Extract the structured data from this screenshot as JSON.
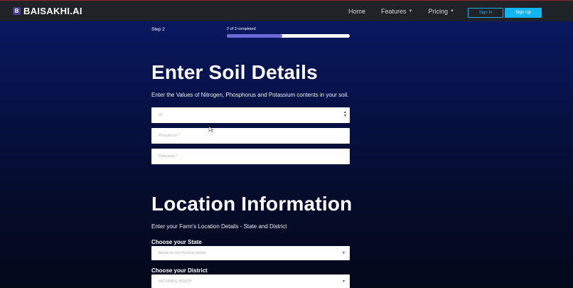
{
  "brand": {
    "badge": "B",
    "name": "BAISAKHI.AI"
  },
  "nav": {
    "home": "Home",
    "features": "Features",
    "pricing": "Pricing",
    "signin": "Sign In",
    "signup": "Sign Up"
  },
  "progress": {
    "step_label": "Step 2",
    "status": "2 of 3 completed",
    "fraction": 0.45
  },
  "soil": {
    "title": "Enter Soil Details",
    "subtitle": "Enter the Values of Nitrogen, Phosphorus and Potassium contents in your soil.",
    "nitrogen_placeholder": "20",
    "phosphorus_placeholder": "Phosphorus *",
    "potassium_placeholder": "Potassium *"
  },
  "location": {
    "title": "Location Information",
    "subtitle": "Enter your Farm's Location Details - State and District",
    "state_label": "Choose your State",
    "state_value": "Andaman and Nicobar Islands",
    "district_label": "Choose your District",
    "district_value": "NICOBARS, NORTH"
  }
}
